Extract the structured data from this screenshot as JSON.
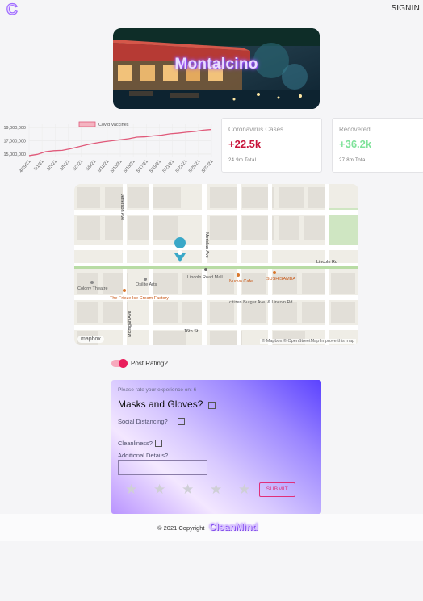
{
  "header": {
    "logo_letter": "C",
    "signin_label": "SIGNIN"
  },
  "hero": {
    "title": "Montalcino"
  },
  "chart_data": {
    "type": "line",
    "legend": [
      "Covid Vaccines"
    ],
    "legend_placement": "top",
    "series": [
      {
        "name": "Covid Vaccines",
        "color": "#e05a7a",
        "values": [
          14750000,
          14950000,
          15350000,
          15500000,
          15550000,
          15800000,
          16100000,
          16400000,
          16650000,
          16850000,
          17000000,
          17150000,
          17300000,
          17550000,
          17600000,
          17750000,
          17850000,
          18050000,
          18150000,
          18300000,
          18400000,
          18600000,
          18700000
        ]
      }
    ],
    "x": [
      "4/29/21",
      "5/1/21",
      "5/3/21",
      "5/5/21",
      "5/7/21",
      "5/9/21",
      "5/11/21",
      "5/13/21",
      "5/15/21",
      "5/17/21",
      "5/19/21",
      "5/21/21",
      "5/23/21",
      "5/25/21",
      "5/27/21"
    ],
    "yticks": [
      "19,000,000",
      "17,000,000",
      "15,000,000"
    ],
    "ylim": [
      14500000,
      19500000
    ],
    "grid": true
  },
  "stats": {
    "cases": {
      "label": "Coronavirus Cases",
      "value": "+22.5k",
      "total": "24.9m Total"
    },
    "recovered": {
      "label": "Recovered",
      "value": "+36.2k",
      "total": "27.8m Total"
    }
  },
  "map": {
    "streets": [
      "Lincoln Rd",
      "16th St",
      "Michigan Ave",
      "Meridian Ave",
      "Jefferson Ave"
    ],
    "places": [
      "Lincoln Road Mall",
      "Colony Theatre",
      "Osilite Arts",
      "Nuovo Cafe",
      "SUSHISAMBA",
      "The Frieze Ice Cream Factory",
      "citizen Burger Ave. & Lincoln Rd."
    ],
    "attribution": "© Mapbox © OpenStreetMap Improve this map",
    "logo": "mapbox",
    "pin_color": "#3aa8c8"
  },
  "toggle": {
    "label": "Post Rating?",
    "on": true
  },
  "rating": {
    "hint": "Please rate your experience on: 6",
    "q_masks": "Masks and Gloves?",
    "q_distancing": "Social Distancing?",
    "q_cleanliness": "Cleanliness?",
    "details_label": "Additional Details?",
    "details_value": "",
    "stars": 5,
    "submit_label": "SUBMIT"
  },
  "footer": {
    "copyright": "© 2021 Copyright",
    "brand": "CleanMind"
  }
}
